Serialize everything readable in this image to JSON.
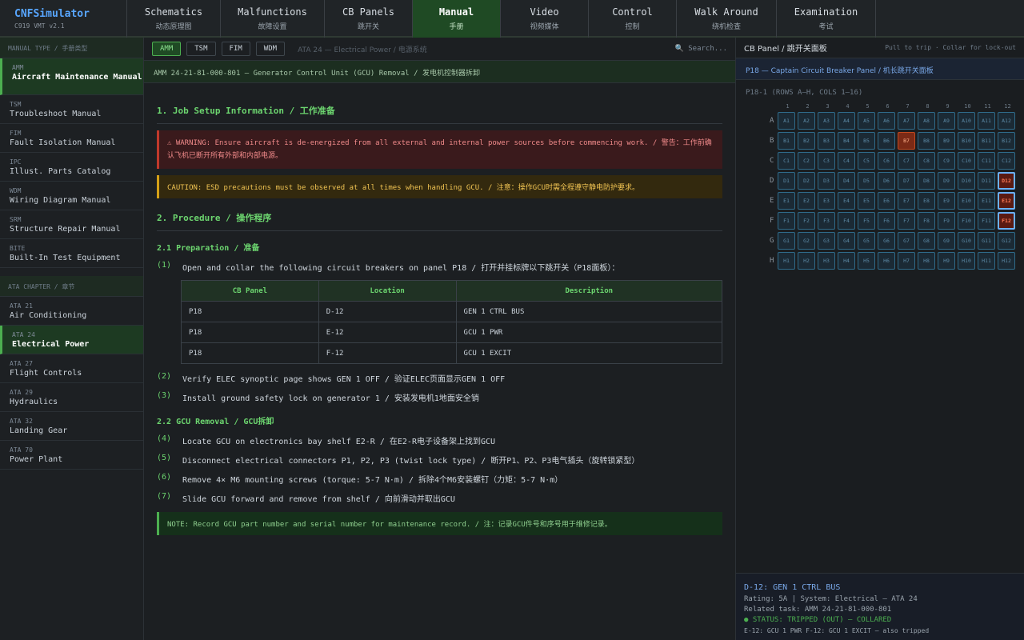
{
  "brand": {
    "name": "CNFSimulator",
    "version": "C919 VMT v2.1"
  },
  "nav": [
    {
      "en": "Schematics",
      "zh": "动态原理图",
      "active": false
    },
    {
      "en": "Malfunctions",
      "zh": "故障设置",
      "active": false
    },
    {
      "en": "CB Panels",
      "zh": "跳开关",
      "active": false
    },
    {
      "en": "Manual",
      "zh": "手册",
      "active": true
    },
    {
      "en": "Video",
      "zh": "视频媒体",
      "active": false
    },
    {
      "en": "Control",
      "zh": "控制",
      "active": false
    },
    {
      "en": "Walk Around",
      "zh": "绕机检查",
      "active": false
    },
    {
      "en": "Examination",
      "zh": "考试",
      "active": false
    }
  ],
  "sidebar": {
    "manual_type_header": "MANUAL TYPE / 手册类型",
    "manuals": [
      {
        "code": "AMM",
        "label": "Aircraft Maintenance Manual",
        "active": true
      },
      {
        "code": "TSM",
        "label": "Troubleshoot Manual",
        "active": false
      },
      {
        "code": "FIM",
        "label": "Fault Isolation Manual",
        "active": false
      },
      {
        "code": "IPC",
        "label": "Illust. Parts Catalog",
        "active": false
      },
      {
        "code": "WDM",
        "label": "Wiring Diagram Manual",
        "active": false
      },
      {
        "code": "SRM",
        "label": "Structure Repair Manual",
        "active": false
      },
      {
        "code": "BITE",
        "label": "Built-In Test Equipment",
        "active": false
      }
    ],
    "chapter_header": "ATA CHAPTER / 章节",
    "chapters": [
      {
        "code": "ATA 21",
        "label": "Air Conditioning",
        "active": false
      },
      {
        "code": "ATA 24",
        "label": "Electrical Power",
        "active": true
      },
      {
        "code": "ATA 27",
        "label": "Flight Controls",
        "active": false
      },
      {
        "code": "ATA 29",
        "label": "Hydraulics",
        "active": false
      },
      {
        "code": "ATA 32",
        "label": "Landing Gear",
        "active": false
      },
      {
        "code": "ATA 70",
        "label": "Power Plant",
        "active": false
      }
    ]
  },
  "toolbar": {
    "buttons": [
      {
        "label": "AMM",
        "active": true
      },
      {
        "label": "TSM",
        "active": false
      },
      {
        "label": "FIM",
        "active": false
      },
      {
        "label": "WDM",
        "active": false
      }
    ],
    "chapter": "ATA 24 — Electrical Power / 电源系统",
    "search": "🔍 Search..."
  },
  "doc": {
    "task_title": "AMM 24-21-81-000-801 — Generator Control Unit (GCU) Removal / 发电机控制器拆卸",
    "section1_title": "1. Job Setup Information / 工作准备",
    "warning": "⚠ WARNING: Ensure aircraft is de-energized from all external and internal power sources before commencing work. / 警告：工作前确认飞机已断开所有外部和内部电源。",
    "caution": "CAUTION: ESD precautions must be observed at all times when handling GCU. / 注意：操作GCU时需全程遵守静电防护要求。",
    "section2_title": "2. Procedure / 操作程序",
    "sub1_title": "2.1 Preparation / 准备",
    "step1": {
      "num": "(1)",
      "text": "Open and collar the following circuit breakers on panel P18 / 打开并挂标牌以下跳开关（P18面板）："
    },
    "table": {
      "headers": [
        "CB Panel",
        "Location",
        "Description"
      ],
      "rows": [
        [
          "P18",
          "D-12",
          "GEN 1 CTRL BUS"
        ],
        [
          "P18",
          "E-12",
          "GCU 1 PWR"
        ],
        [
          "P18",
          "F-12",
          "GCU 1 EXCIT"
        ]
      ]
    },
    "steps_a": [
      {
        "num": "(2)",
        "text": "Verify ELEC synoptic page shows GEN 1 OFF / 验证ELEC页面显示GEN 1 OFF"
      },
      {
        "num": "(3)",
        "text": "Install ground safety lock on generator 1 / 安装发电机1地面安全销"
      }
    ],
    "sub2_title": "2.2 GCU Removal / GCU拆卸",
    "steps_b": [
      {
        "num": "(4)",
        "text": "Locate GCU on electronics bay shelf E2-R / 在E2-R电子设备架上找到GCU"
      },
      {
        "num": "(5)",
        "text": "Disconnect electrical connectors P1, P2, P3 (twist lock type) / 断开P1、P2、P3电气插头（旋转锁紧型）"
      },
      {
        "num": "(6)",
        "text": "Remove 4× M6 mounting screws (torque: 5-7 N·m) / 拆除4个M6安装螺钉（力矩：5-7 N·m）"
      },
      {
        "num": "(7)",
        "text": "Slide GCU forward and remove from shelf / 向前滑动并取出GCU"
      }
    ],
    "note": "NOTE: Record GCU part number and serial number for maintenance record. / 注：记录GCU件号和序号用于维修记录。"
  },
  "cbpanel": {
    "title": "CB Panel / 跳开关面板",
    "hint": "Pull to trip · Collar for lock-out",
    "panel_name": "P18 — Captain Circuit Breaker Panel / 机长跳开关面板",
    "grid_label": "P18-1 (ROWS A–H, COLS 1–16)",
    "rows": [
      "A",
      "B",
      "C",
      "D",
      "E",
      "F",
      "G",
      "H"
    ],
    "cols": 12,
    "tripped": [
      "B7"
    ],
    "collared": [
      "D12",
      "E12",
      "F12"
    ],
    "info": {
      "title": "D-12: GEN 1 CTRL BUS",
      "rating": "Rating: 5A  |  System: Electrical — ATA 24",
      "related_task": "Related task: AMM 24-21-81-000-801",
      "status": "● STATUS: TRIPPED (OUT) — COLLARED",
      "related": "E-12: GCU 1 PWR   F-12: GCU 1 EXCIT — also tripped"
    }
  }
}
